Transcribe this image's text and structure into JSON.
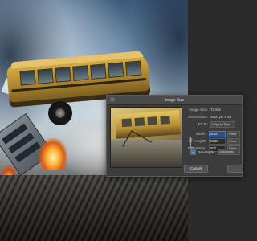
{
  "dialog": {
    "title": "Image Size",
    "image_size_label": "Image Size:",
    "image_size_value": "72.6M",
    "dimensions_label": "Dimensions:",
    "dimensions_value": "4500 px × 56",
    "fit_to_label": "Fit To:",
    "fit_to_value": "Original Size",
    "width_label": "Width:",
    "width_value": "4500",
    "width_unit": "Pixel",
    "height_label": "Height:",
    "height_value": "5638",
    "height_unit": "Pixel",
    "resolution_label": "Resolution:",
    "resolution_value": "300",
    "resolution_unit": "Pixel",
    "resample_label": "Resample:",
    "resample_value": "Automatic",
    "cancel_label": "Cancel"
  },
  "icons": {
    "close": "close-icon",
    "link": "chain-link-icon",
    "check": "checkbox-check-icon"
  },
  "colors": {
    "dialog_bg": "#3c3c3c",
    "workspace_bg": "#2b2b2b",
    "accent": "#3c7ad6"
  }
}
